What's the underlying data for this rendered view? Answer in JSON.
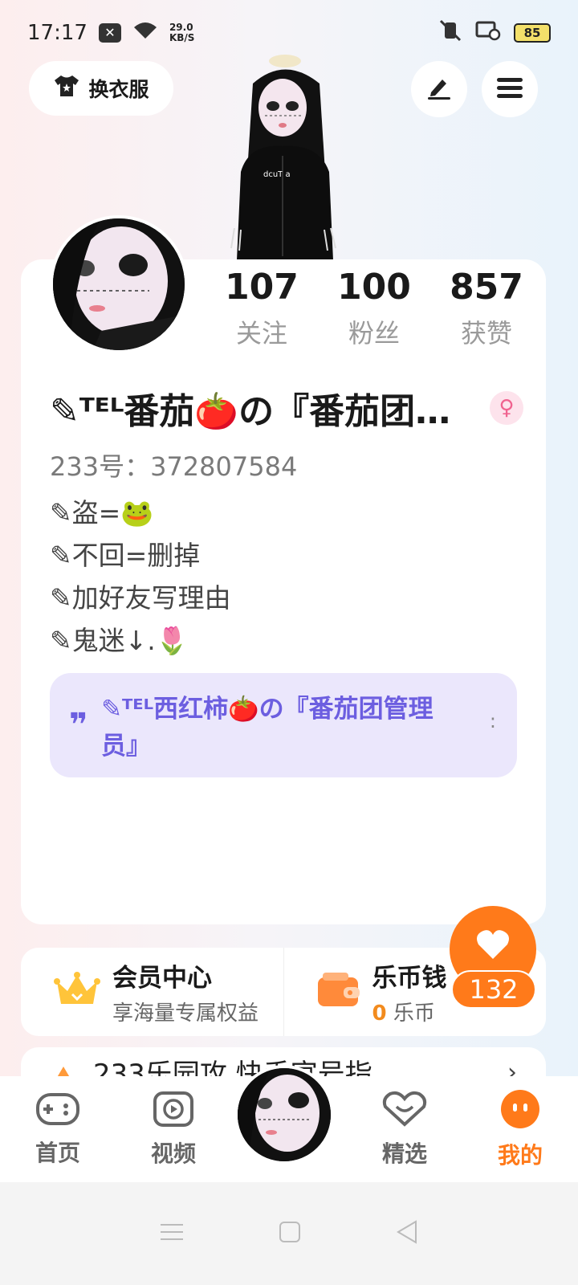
{
  "status_bar": {
    "time": "17:17",
    "net_speed_value": "29.0",
    "net_speed_unit": "KB/S",
    "battery": "85"
  },
  "header": {
    "outfit_label": "换衣服"
  },
  "stats": [
    {
      "value": "107",
      "label": "关注"
    },
    {
      "value": "100",
      "label": "粉丝"
    },
    {
      "value": "857",
      "label": "获赞"
    }
  ],
  "profile": {
    "nickname": "✎ᵀᴱᴸ番茄🍅の『番茄团…",
    "gender_symbol": "♀",
    "uid": "233号：372807584",
    "bio_lines": [
      "✎盗=🐸",
      "✎不回=删掉",
      "✎加好友写理由",
      "✎鬼迷↓.🌷"
    ]
  },
  "quote": {
    "text": "✎ᵀᴱᴸ西红柿🍅の『番茄团管理员』"
  },
  "member": {
    "title": "会员中心",
    "subtitle": "享海量专属权益"
  },
  "wallet": {
    "title": "乐币钱",
    "coin_value": "0",
    "coin_unit": "乐币"
  },
  "like": {
    "count": "132"
  },
  "partial_card": {
    "text": "233乐园攻 快手官号指"
  },
  "bottom_nav": [
    {
      "label": "首页"
    },
    {
      "label": "视频"
    },
    {
      "label": "精选"
    },
    {
      "label": "我的"
    }
  ],
  "colors": {
    "accent": "#ff7a1a",
    "quote_text": "#6c5ee0",
    "quote_bg": "#ebe7fc"
  }
}
